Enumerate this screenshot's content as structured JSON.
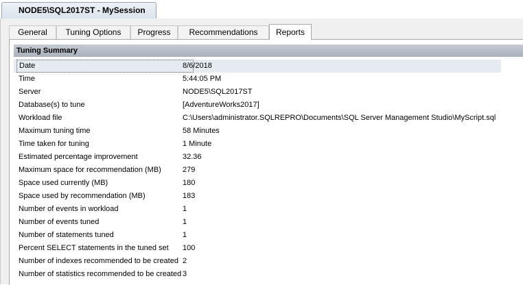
{
  "document_tab": {
    "title": "NODE5\\SQL2017ST - MySession"
  },
  "tabs": [
    {
      "label": "General"
    },
    {
      "label": "Tuning Options"
    },
    {
      "label": "Progress"
    },
    {
      "label": "Recommendations"
    },
    {
      "label": "Reports"
    }
  ],
  "active_tab": "Reports",
  "summary": {
    "header": "Tuning Summary",
    "rows": [
      {
        "label": "Date",
        "value": "8/6/2018"
      },
      {
        "label": "Time",
        "value": "5:44:05 PM"
      },
      {
        "label": "Server",
        "value": "NODE5\\SQL2017ST"
      },
      {
        "label": "Database(s) to tune",
        "value": "[AdventureWorks2017]"
      },
      {
        "label": "Workload file",
        "value": "C:\\Users\\administrator.SQLREPRO\\Documents\\SQL Server Management Studio\\MyScript.sql"
      },
      {
        "label": "Maximum tuning time",
        "value": "58 Minutes"
      },
      {
        "label": "Time taken for tuning",
        "value": "1 Minute"
      },
      {
        "label": "Estimated percentage improvement",
        "value": "32.36"
      },
      {
        "label": "Maximum space for recommendation (MB)",
        "value": "279"
      },
      {
        "label": "Space used currently (MB)",
        "value": "180"
      },
      {
        "label": "Space used by recommendation (MB)",
        "value": "183"
      },
      {
        "label": "Number of events in workload",
        "value": "1"
      },
      {
        "label": "Number of events tuned",
        "value": "1"
      },
      {
        "label": "Number of statements tuned",
        "value": "1"
      },
      {
        "label": "Percent SELECT statements in the tuned set",
        "value": "100"
      },
      {
        "label": "Number of indexes recommended to be created",
        "value": "2"
      },
      {
        "label": "Number of statistics recommended to be created",
        "value": "3"
      }
    ]
  }
}
